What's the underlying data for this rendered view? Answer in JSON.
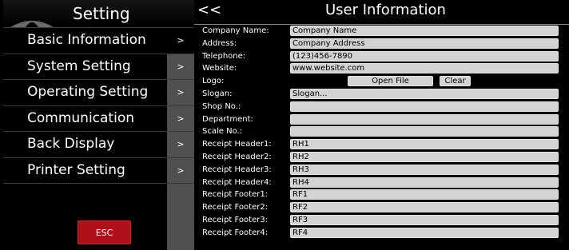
{
  "sidebar": {
    "title": "Setting",
    "items": [
      {
        "label": "Basic Information",
        "arrow": ">"
      },
      {
        "label": "System Setting",
        "arrow": ">"
      },
      {
        "label": "Operating Setting",
        "arrow": ">"
      },
      {
        "label": "Communication",
        "arrow": ">"
      },
      {
        "label": "Back Display",
        "arrow": ">"
      },
      {
        "label": "Printer Setting",
        "arrow": ">"
      }
    ],
    "esc_label": "ESC"
  },
  "header": {
    "back_label": "<<",
    "title": "User Information"
  },
  "form": {
    "company_name": {
      "label": "Company Name:",
      "value": "Company Name"
    },
    "address": {
      "label": "Address:",
      "value": "Company Address"
    },
    "telephone": {
      "label": "Telephone:",
      "value": "(123)456-7890"
    },
    "website": {
      "label": "Website:",
      "value": "www.website.com"
    },
    "logo": {
      "label": "Logo:",
      "open_file": "Open File",
      "clear": "Clear"
    },
    "slogan": {
      "label": "Slogan:",
      "value": "Slogan..."
    },
    "shop_no": {
      "label": "Shop No.:",
      "value": ""
    },
    "department": {
      "label": "Department:",
      "value": ""
    },
    "scale_no": {
      "label": "Scale No.:",
      "value": ""
    },
    "receipt_header1": {
      "label": "Receipt Header1:",
      "value": "RH1"
    },
    "receipt_header2": {
      "label": "Receipt Header2:",
      "value": "RH2"
    },
    "receipt_header3": {
      "label": "Receipt Header3:",
      "value": "RH3"
    },
    "receipt_header4": {
      "label": "Receipt Header4:",
      "value": "RH4"
    },
    "receipt_footer1": {
      "label": "Receipt Footer1:",
      "value": "RF1"
    },
    "receipt_footer2": {
      "label": "Receipt Footer2:",
      "value": "RF2"
    },
    "receipt_footer3": {
      "label": "Receipt Footer3:",
      "value": "RF3"
    },
    "receipt_footer4": {
      "label": "Receipt Footer4:",
      "value": "RF4"
    }
  },
  "colors": {
    "background": "#000000",
    "field": "#d3d3d3",
    "arrow_column": "#505050",
    "esc_button": "#b01018"
  }
}
